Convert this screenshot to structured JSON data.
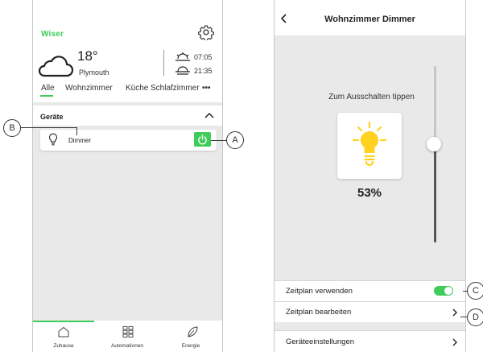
{
  "left_screen": {
    "logo_text": "Wiser",
    "weather": {
      "temperature": "18°",
      "city": "Plymouth",
      "sunrise": "07:05",
      "sunset": "21:35"
    },
    "tabs": [
      "Alle",
      "Wohnzimmer",
      "Küche",
      "Schlafzimmer"
    ],
    "tabs_more": "•••",
    "section_title": "Geräte",
    "device": {
      "name": "Dimmer"
    },
    "nav": [
      "Zuhause",
      "Automationen",
      "Energie"
    ]
  },
  "right_screen": {
    "title": "Wohnzimmer Dimmer",
    "tap_hint": "Zum Ausschalten tippen",
    "brightness_percent": "53%",
    "brightness_level": 0.53,
    "settings": {
      "use_schedule": "Zeitplan verwenden",
      "edit_schedule": "Zeitplan bearbeiten",
      "device_settings": "Geräteeinstellungen"
    },
    "use_schedule_on": true
  },
  "callouts": {
    "a": "A",
    "b": "B",
    "c": "C",
    "d": "D"
  },
  "colors": {
    "accent": "#3dcd58",
    "bulb_yellow": "#ffd21f",
    "background": "#e9e9e9"
  }
}
